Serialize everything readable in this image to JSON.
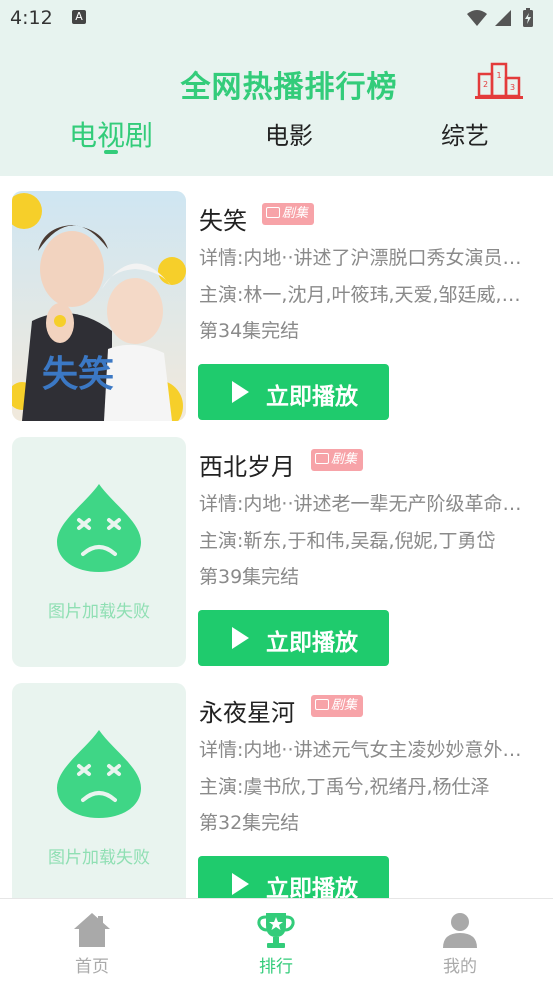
{
  "status_bar": {
    "time": "4:12",
    "indicator": "A"
  },
  "header": {
    "title": "全网热播排行榜",
    "rank_icon": "podium-icon"
  },
  "tabs": [
    {
      "label": "电视剧",
      "active": true
    },
    {
      "label": "电影",
      "active": false
    },
    {
      "label": "综艺",
      "active": false
    }
  ],
  "items": [
    {
      "title": "失笑",
      "badge": "剧集",
      "detail": "详情:内地··讲述了沪漂脱口秀女演员…",
      "cast": "主演:林一,沈月,叶筱玮,天爱,邹廷威,…",
      "status": "第34集完结",
      "play_label": "立即播放",
      "poster_loaded": true,
      "poster_text": "失笑"
    },
    {
      "title": "西北岁月",
      "badge": "剧集",
      "detail": "详情:内地··讲述老一辈无产阶级革命…",
      "cast": "主演:靳东,于和伟,吴磊,倪妮,丁勇岱",
      "status": "第39集完结",
      "play_label": "立即播放",
      "poster_loaded": false,
      "poster_failed_text": "图片加载失败"
    },
    {
      "title": "永夜星河",
      "badge": "剧集",
      "detail": "详情:内地··讲述元气女主凌妙妙意外…",
      "cast": "主演:虞书欣,丁禹兮,祝绪丹,杨仕泽",
      "status": "第32集完结",
      "play_label": "立即播放",
      "poster_loaded": false,
      "poster_failed_text": "图片加载失败"
    }
  ],
  "bottom_nav": [
    {
      "label": "首页",
      "icon": "home-icon",
      "active": false
    },
    {
      "label": "排行",
      "icon": "trophy-icon",
      "active": true
    },
    {
      "label": "我的",
      "icon": "user-icon",
      "active": false
    }
  ],
  "colors": {
    "accent": "#33cc7a",
    "play_button": "#1fcb6d",
    "badge": "#f7a3a8",
    "header_bg": "#e7f3ef"
  }
}
